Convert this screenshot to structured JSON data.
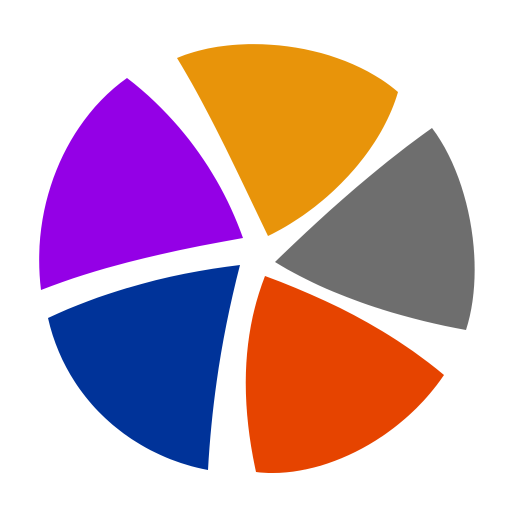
{
  "logo": {
    "icon": "aperture-pinwheel-icon",
    "background": "#ffffff",
    "segments": [
      {
        "key": "orange",
        "color": "#E8940A"
      },
      {
        "key": "gray",
        "color": "#6E6E6E"
      },
      {
        "key": "red-orange",
        "color": "#E64400"
      },
      {
        "key": "blue",
        "color": "#003399"
      },
      {
        "key": "purple",
        "color": "#9400E6"
      }
    ]
  }
}
